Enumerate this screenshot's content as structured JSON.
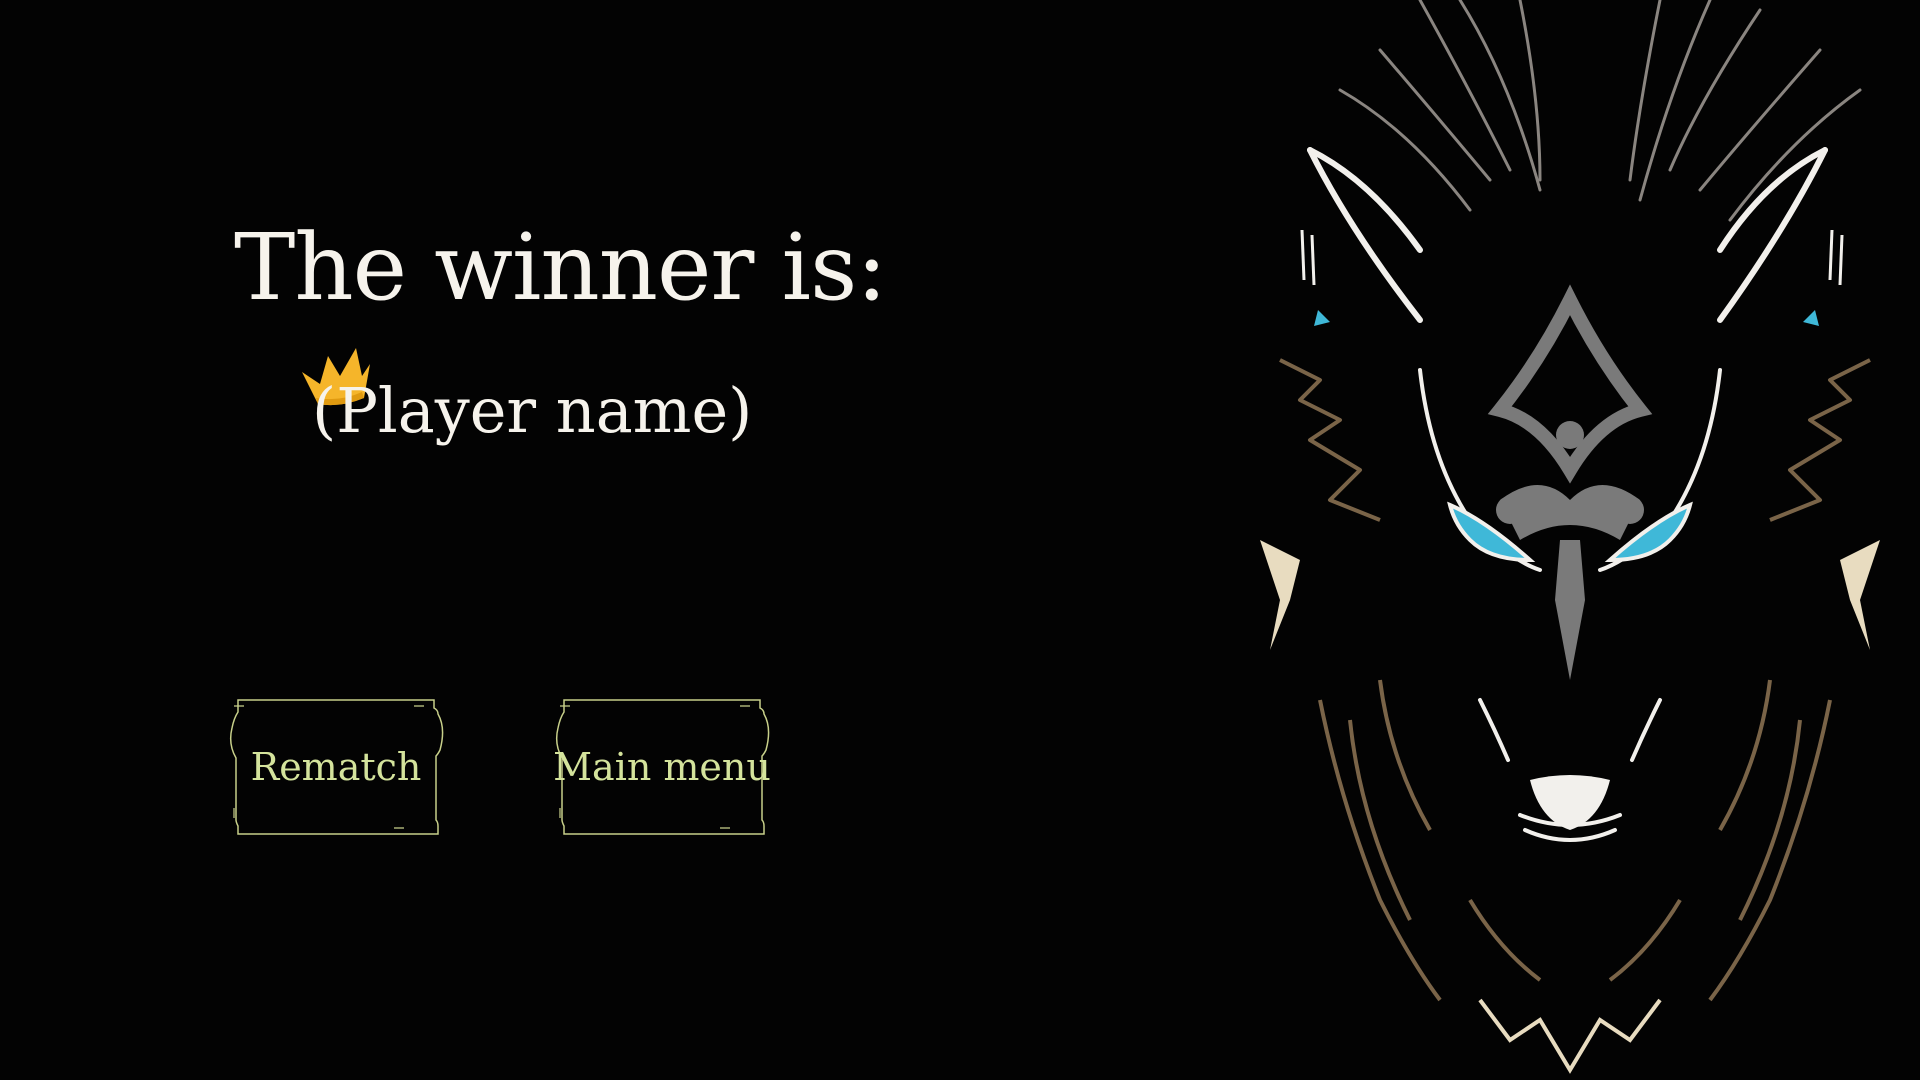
{
  "result": {
    "title": "The winner is:",
    "player_name": "(Player name)"
  },
  "buttons": {
    "rematch_label": "Rematch",
    "main_menu_label": "Main menu"
  },
  "icons": {
    "crown": "crown-icon",
    "artwork": "wolf-illustration"
  },
  "colors": {
    "background": "#030303",
    "title_text": "#f6f3ec",
    "button_text": "#d4e39c",
    "button_border": "#c8d08a",
    "crown": "#f5b52a",
    "wolf_eyes": "#3fb8d8"
  }
}
